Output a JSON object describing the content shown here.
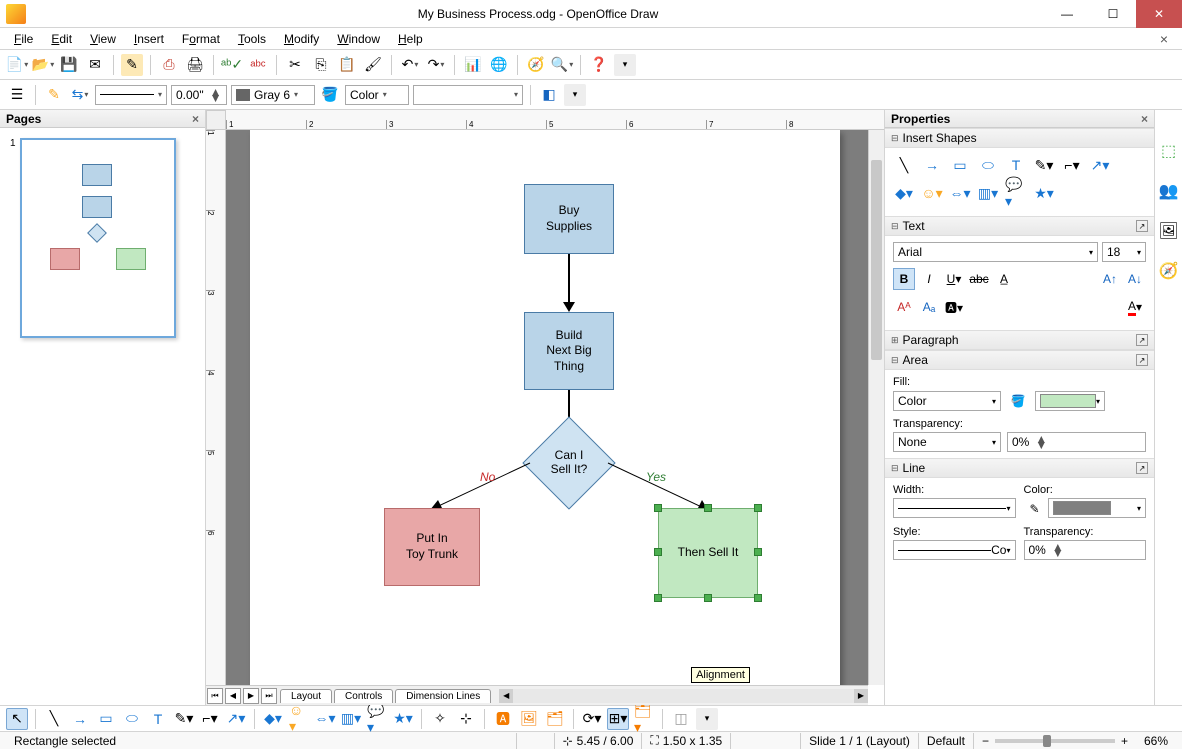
{
  "window": {
    "title": "My Business Process.odg - OpenOffice Draw"
  },
  "menus": [
    "File",
    "Edit",
    "View",
    "Insert",
    "Format",
    "Tools",
    "Modify",
    "Window",
    "Help"
  ],
  "toolbar2": {
    "line_width": "0.00\"",
    "line_color_name": "Gray 6",
    "fill_mode_label": "Color"
  },
  "pages_panel": {
    "title": "Pages"
  },
  "tabs": {
    "names": [
      "Layout",
      "Controls",
      "Dimension Lines"
    ],
    "tooltip": "Alignment"
  },
  "flowchart": {
    "box1": "Buy\nSupplies",
    "box2": "Build\nNext Big\nThing",
    "decision": "Can I\nSell It?",
    "no_label": "No",
    "yes_label": "Yes",
    "box_left": "Put In\nToy Trunk",
    "box_right": "Then Sell It"
  },
  "properties": {
    "title": "Properties",
    "sec_shapes": "Insert Shapes",
    "sec_text": "Text",
    "font_name": "Arial",
    "font_size": "18",
    "sec_paragraph": "Paragraph",
    "sec_area": "Area",
    "fill_label": "Fill:",
    "fill_mode": "Color",
    "fill_color": "#c1e8c1",
    "transparency_label": "Transparency:",
    "transparency_mode": "None",
    "transparency_value": "0%",
    "sec_line": "Line",
    "width_label": "Width:",
    "color_label": "Color:",
    "line_color": "#808080",
    "style_label": "Style:",
    "style_value": "Co",
    "line_transp_label": "Transparency:",
    "line_transp_value": "0%"
  },
  "status": {
    "selection": "Rectangle selected",
    "pos": "5.45 / 6.00",
    "size": "1.50 x 1.35",
    "slide": "Slide 1 / 1 (Layout)",
    "style": "Default",
    "zoom": "66%"
  }
}
